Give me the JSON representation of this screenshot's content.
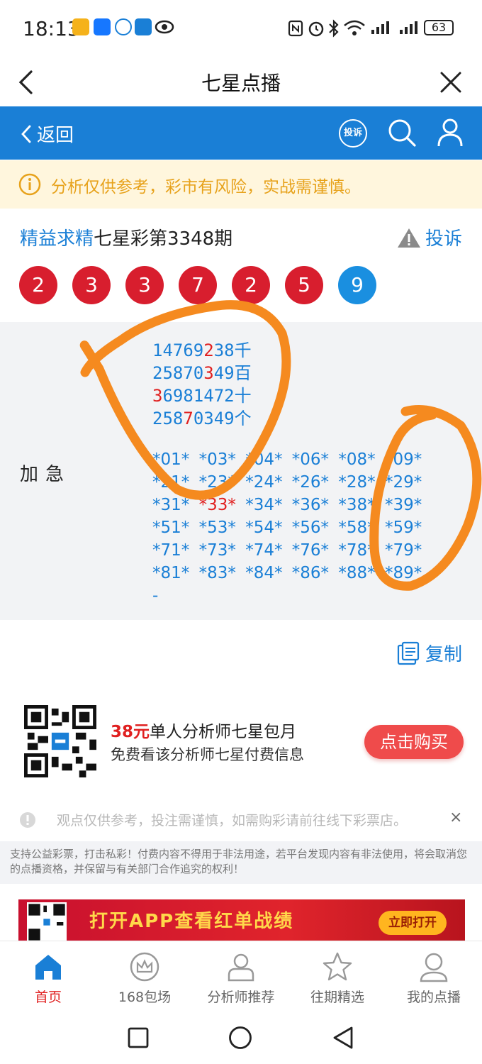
{
  "status_bar": {
    "time": "18:13",
    "battery": "63"
  },
  "title_bar": {
    "title": "七星点播",
    "back_icon": "chevron-left-icon",
    "close_icon": "close-icon"
  },
  "nav": {
    "back_label": "返回",
    "complaint_badge": "投诉"
  },
  "warning": {
    "text": "分析仅供参考，彩市有风险，实战需谨慎。"
  },
  "header": {
    "brand": "精益求精",
    "title": "七星彩第3348期",
    "complaint_label": "投诉"
  },
  "draw_balls": [
    {
      "value": "2",
      "color": "#d81e2e"
    },
    {
      "value": "3",
      "color": "#d81e2e"
    },
    {
      "value": "3",
      "color": "#d81e2e"
    },
    {
      "value": "7",
      "color": "#d81e2e"
    },
    {
      "value": "2",
      "color": "#d81e2e"
    },
    {
      "value": "5",
      "color": "#d81e2e"
    },
    {
      "value": "9",
      "color": "#1a8fe0"
    }
  ],
  "content": {
    "label": "加急",
    "lines": [
      {
        "pre": "14769",
        "hit": "2",
        "post": "38",
        "unit": "千"
      },
      {
        "pre": "25870",
        "hit": "3",
        "post": "49",
        "unit": "百"
      },
      {
        "pre": "",
        "hit": "3",
        "post": "6981472",
        "unit": "十"
      },
      {
        "pre": "258",
        "hit": "7",
        "post": "0349",
        "unit": "个"
      }
    ],
    "tokens": [
      "*01*",
      "*03*",
      "*04*",
      "*06*",
      "*08*",
      "*09*",
      "*21*",
      "*23*",
      "*24*",
      "*26*",
      "*28*",
      "*29*",
      "*31*",
      "*33*",
      "*34*",
      "*36*",
      "*38*",
      "*39*",
      "*51*",
      "*53*",
      "*54*",
      "*56*",
      "*58*",
      "*59*",
      "*71*",
      "*73*",
      "*74*",
      "*76*",
      "*78*",
      "*79*",
      "*81*",
      "*83*",
      "*84*",
      "*86*",
      "*88*",
      "*89*"
    ],
    "highlight_token": "*33*",
    "end_mark": "-"
  },
  "copy_label": "复制",
  "promo": {
    "price": "38元",
    "title_rest": "单人分析师七星包月",
    "subtitle": "免费看该分析师七星付费信息",
    "buy_label": "点击购买"
  },
  "notice": {
    "text": "观点仅供参考，投注需谨慎，如需购彩请前往线下彩票店。",
    "close": "×"
  },
  "disclaimer": "支持公益彩票，打击私彩！付费内容不得用于非法用途，若平台发现内容有非法使用，将会取消您的点播资格，并保留与有关部门合作追究的权利！",
  "banner": {
    "text": "打开APP查看红单战绩",
    "button": "立即打开"
  },
  "tabs": [
    {
      "label": "首页",
      "icon": "home-icon",
      "active": true
    },
    {
      "label": "168包场",
      "icon": "crown-icon",
      "active": false
    },
    {
      "label": "分析师推荐",
      "icon": "analyst-icon",
      "active": false
    },
    {
      "label": "往期精选",
      "icon": "star-icon",
      "active": false
    },
    {
      "label": "我的点播",
      "icon": "profile-icon",
      "active": false
    }
  ]
}
